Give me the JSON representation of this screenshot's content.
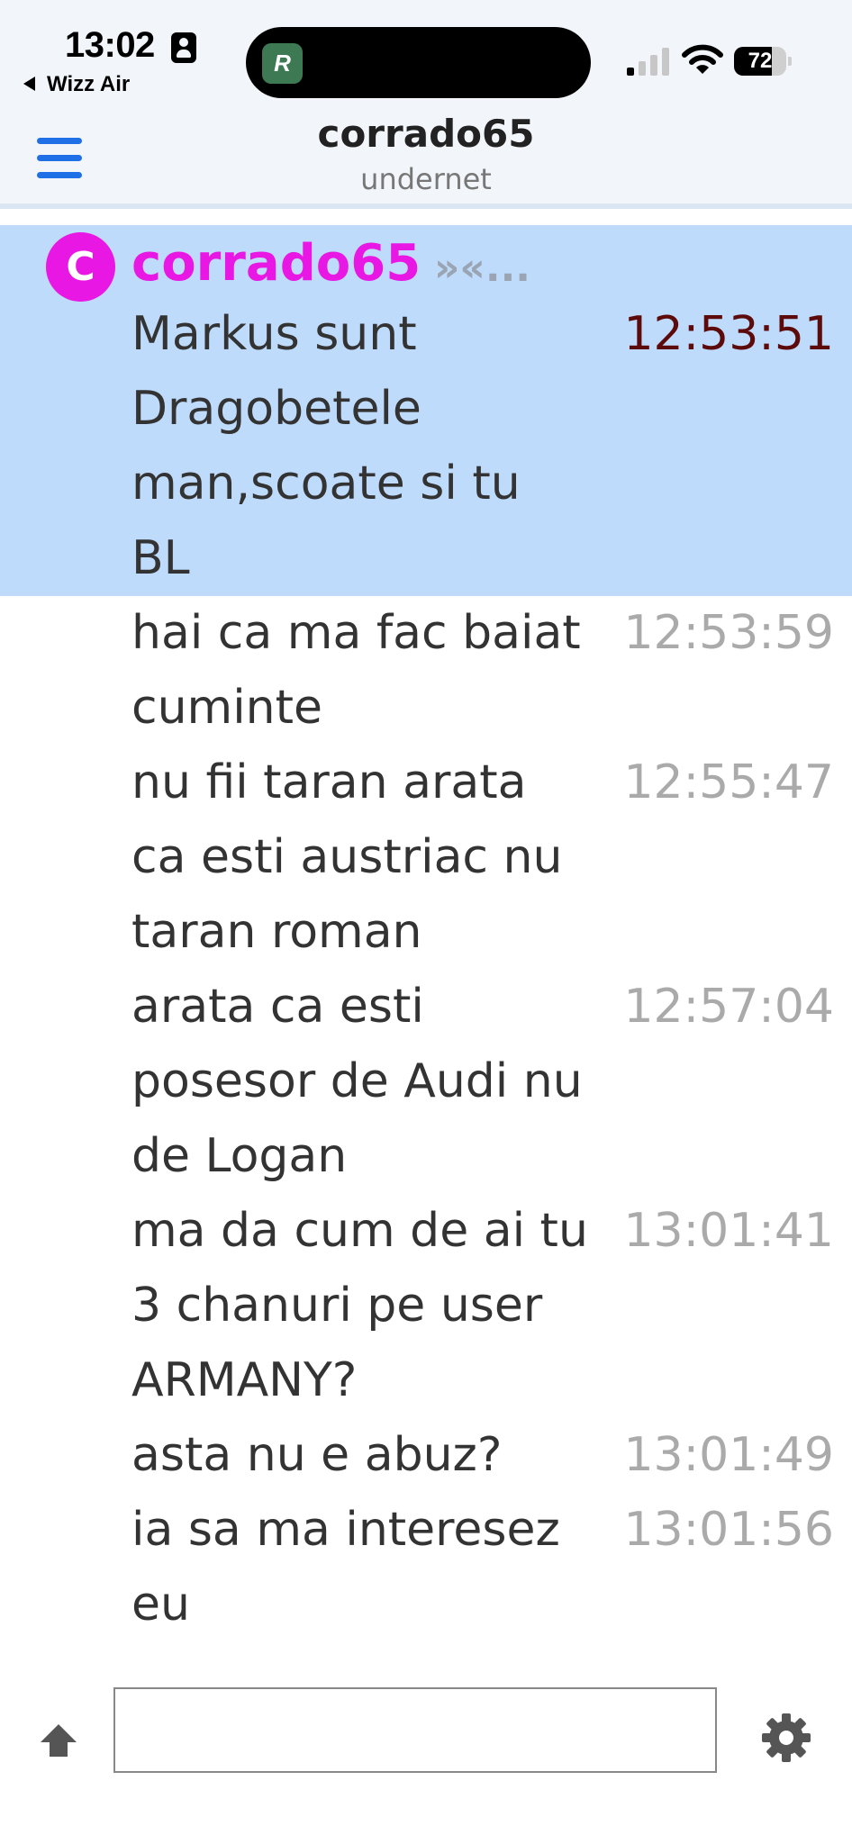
{
  "status_bar": {
    "time": "13:02",
    "back_app": "Wizz Air",
    "island_app_letter": "R",
    "battery_level": "72",
    "battery_fraction": 0.72,
    "icons": [
      "lock-icon",
      "signal-icon",
      "wifi-icon",
      "battery-icon"
    ]
  },
  "header": {
    "title": "corrado65",
    "network": "undernet",
    "menu_icon": "hamburger-menu-icon"
  },
  "colors": {
    "accent": "#1f6fe6",
    "nick": "#e817e3",
    "highlight": "#bfdbfc",
    "highlight_time": "#5c0a0a",
    "timestamp": "#aaaaaa"
  },
  "messages": {
    "first": {
      "avatar_letter": "C",
      "nick": "corrado65",
      "nick_suffix": "»«...",
      "text": "Markus sunt Dragobetele man,scoate si tu BL",
      "time": "12:53:51"
    },
    "items": [
      {
        "text": "hai ca ma fac baiat cuminte",
        "time": "12:53:59"
      },
      {
        "text": "nu fii taran arata ca esti austriac nu taran roman",
        "time": "12:55:47"
      },
      {
        "text": "arata ca esti posesor de Audi nu de Logan",
        "time": "12:57:04"
      },
      {
        "text": "ma da cum de ai tu 3 chanuri pe user ARMANY?",
        "time": "13:01:41"
      },
      {
        "text": "asta nu e abuz?",
        "time": "13:01:49"
      },
      {
        "text": "ia sa ma interesez eu",
        "time": "13:01:56"
      }
    ]
  },
  "input_bar": {
    "value": "",
    "placeholder": "",
    "shift_icon": "shift-arrow-icon",
    "settings_icon": "gear-icon"
  }
}
